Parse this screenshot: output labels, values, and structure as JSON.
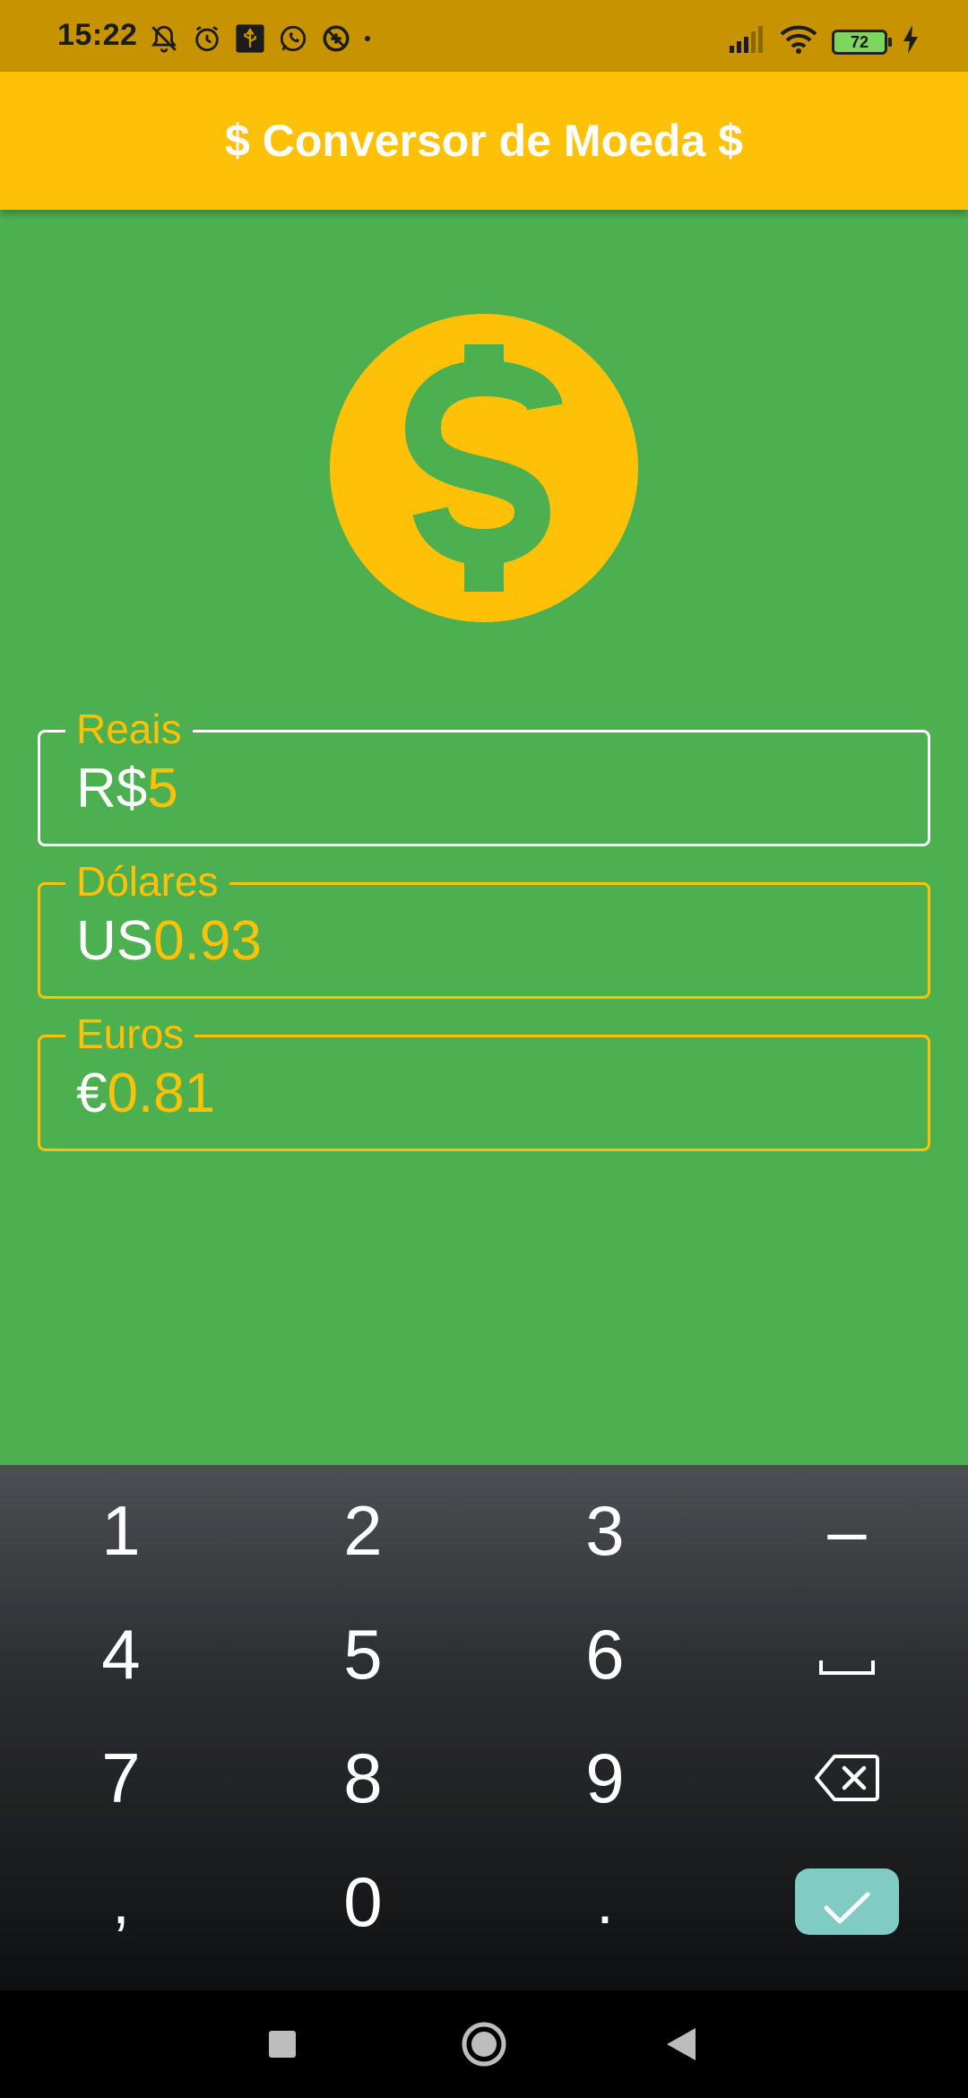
{
  "status_bar": {
    "time": "15:22",
    "battery": "72",
    "icons": [
      "mute-bell-icon",
      "alarm-icon",
      "usb-icon",
      "whatsapp-icon",
      "data-saver-icon",
      "dot-icon",
      "signal-icon",
      "wifi-icon",
      "battery-icon",
      "charging-icon"
    ]
  },
  "app_bar": {
    "title": "$ Conversor de Moeda $"
  },
  "hero": {
    "icon": "dollar-coin-icon"
  },
  "fields": {
    "reais": {
      "label": "Reais",
      "prefix": "R$",
      "value": "5"
    },
    "dolares": {
      "label": "Dólares",
      "prefix": "US",
      "value": "0.93"
    },
    "euros": {
      "label": "Euros",
      "prefix": "€",
      "value": "0.81"
    }
  },
  "keyboard": {
    "keys": {
      "k1": "1",
      "k2": "2",
      "k3": "3",
      "minus": "–",
      "k4": "4",
      "k5": "5",
      "k6": "6",
      "k7": "7",
      "k8": "8",
      "k9": "9",
      "comma": ",",
      "k0": "0",
      "period": "."
    },
    "icons": [
      "space-icon",
      "backspace-icon",
      "check-icon"
    ]
  },
  "nav_bar": {
    "icons": [
      "recents-icon",
      "home-icon",
      "back-icon"
    ]
  },
  "colors": {
    "background": "#4CAF50",
    "accent": "#FFC107",
    "status_bar": "#C79400",
    "enter_key": "#80CBC4"
  }
}
